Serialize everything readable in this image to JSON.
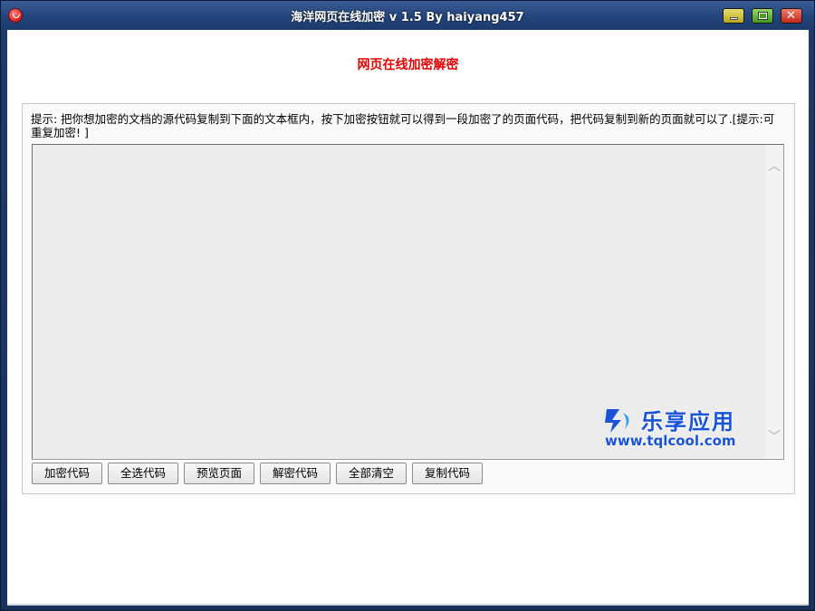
{
  "window": {
    "title": "海洋网页在线加密 v 1.5  By haiyang457",
    "buttons": {
      "minimize": "",
      "maximize": "",
      "close": "✕"
    }
  },
  "main": {
    "heading": "网页在线加密解密",
    "hint": "提示: 把你想加密的文档的源代码复制到下面的文本框内，按下加密按钮就可以得到一段加密了的页面代码，把代码复制到新的页面就可以了.[提示:可重复加密! ]",
    "editor": {
      "value": ""
    },
    "actions": [
      {
        "label": "加密代码"
      },
      {
        "label": "全选代码"
      },
      {
        "label": "预览页面"
      },
      {
        "label": "解密代码"
      },
      {
        "label": "全部清空"
      },
      {
        "label": "复制代码"
      }
    ]
  },
  "watermark": {
    "name": "乐享应用",
    "url": "www.tqlcool.com"
  },
  "colors": {
    "heading": "#e00000",
    "title_bar": "#24467d",
    "editor_bg": "#ececec",
    "watermark": "#1a54d6"
  },
  "icons": {
    "app": "app-icon",
    "scroll_up": "chevron-up-icon",
    "scroll_down": "chevron-down-icon"
  }
}
